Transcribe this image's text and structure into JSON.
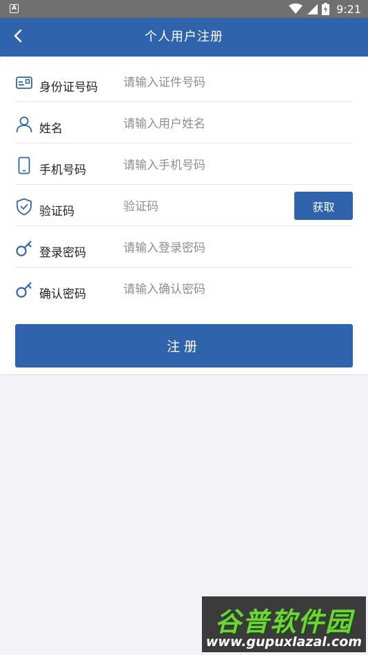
{
  "status_bar": {
    "notification_icon": "A",
    "time": "9:21",
    "icons": [
      "wifi-icon",
      "signal-icon",
      "battery-icon"
    ]
  },
  "app_bar": {
    "title": "个人用户注册",
    "back_icon": "chevron-left-icon"
  },
  "form": {
    "rows": [
      {
        "label": "身份证号码",
        "placeholder": "请输入证件号码",
        "icon": "id-card-icon"
      },
      {
        "label": "姓名",
        "placeholder": "请输入用户姓名",
        "icon": "user-icon"
      },
      {
        "label": "手机号码",
        "placeholder": "请输入手机号码",
        "icon": "phone-icon"
      },
      {
        "label": "验证码",
        "placeholder": "验证码",
        "icon": "shield-check-icon",
        "button": "获取"
      },
      {
        "label": "登录密码",
        "placeholder": "请输入登录密码",
        "icon": "key-icon"
      },
      {
        "label": "确认密码",
        "placeholder": "请输入确认密码",
        "icon": "key-icon"
      }
    ],
    "submit_label": "注册"
  },
  "colors": {
    "primary": "#2f64ad",
    "status_bar": "#707070",
    "background": "#f2f2f7"
  },
  "watermark": {
    "title": "谷普软件园",
    "url": "www.gupuxlazal.com"
  }
}
